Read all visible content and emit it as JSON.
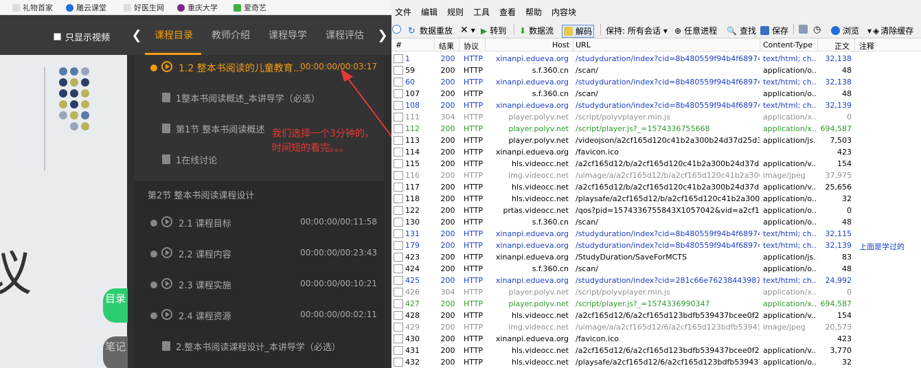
{
  "bookmarks": [
    "礼物首家",
    "雕云课堂",
    "好医生网",
    "重庆大学",
    "爱奇艺"
  ],
  "player": {
    "only_video_label": "只显示视频",
    "tabs": [
      "课程目录",
      "教师介绍",
      "课程导学",
      "课程评估"
    ],
    "active_tab": "课程目录",
    "left_arrow": "❮",
    "right_arrow": "❯",
    "lessons": [
      {
        "type": "video",
        "title": "1.2 整本书阅读的儿童教育...",
        "time": "00:00:00/00:03:17",
        "current": true
      },
      {
        "type": "doc",
        "title": "1整本书阅读概述_本讲导学（必选）",
        "time": ""
      },
      {
        "type": "doc",
        "title": "第1节 整本书阅读概述",
        "time": ""
      },
      {
        "type": "doc",
        "title": "1在线讨论",
        "time": ""
      }
    ],
    "section2_title": "第2节 整本书阅读课程设计",
    "lessons2": [
      {
        "type": "video",
        "title": "2.1 课程目标",
        "time": "00:00:00/00:11:58"
      },
      {
        "type": "video",
        "title": "2.2 课程内容",
        "time": "00:00:00/00:23:43"
      },
      {
        "type": "video",
        "title": "2.3 课程实施",
        "time": "00:00:00/00:10:21"
      },
      {
        "type": "video",
        "title": "2.4 课程资源",
        "time": "00:00:00/00:02:11"
      },
      {
        "type": "doc",
        "title": "2.整本书阅读课程设计_本讲导学（必选）",
        "time": ""
      }
    ],
    "annotation_line1": "我们选择一个3分钟的，",
    "annotation_line2": "时间短的看完。。。",
    "mulu": "目录",
    "biji": "笔记",
    "slide_char": "议"
  },
  "fiddler": {
    "menu": [
      "文件",
      "编辑",
      "规则",
      "工具",
      "查看",
      "帮助",
      "内容块"
    ],
    "toolbar": [
      "数据重放",
      "转到",
      "数据流",
      "解码",
      "保持: 所有会话",
      "任意进程",
      "查找",
      "保存",
      "浏览",
      "清除缓存"
    ],
    "columns": [
      "#",
      "结果",
      "协议",
      "Host",
      "URL",
      "Content-Type",
      "正文",
      "注释"
    ],
    "rows": [
      {
        "num": "1",
        "res": "200",
        "pro": "HTTP",
        "host": "xinanpi.edueva.org",
        "url": "/studyduration/index?cid=8b480559f94b4f689746...",
        "ct": "text/html; ch...",
        "body": "32,138",
        "note": "",
        "color": "#1a3fc4"
      },
      {
        "num": "59",
        "res": "200",
        "pro": "HTTP",
        "host": "s.f.360.cn",
        "url": "/scan/",
        "ct": "application/o...",
        "body": "48",
        "note": "",
        "color": "#000000"
      },
      {
        "num": "60",
        "res": "200",
        "pro": "HTTP",
        "host": "xinanpi.edueva.org",
        "url": "/studyduration/index?cid=8b480559f94b4f689746...",
        "ct": "text/html; ch...",
        "body": "32,138",
        "note": "",
        "color": "#1a3fc4"
      },
      {
        "num": "107",
        "res": "200",
        "pro": "HTTP",
        "host": "s.f.360.cn",
        "url": "/scan/",
        "ct": "application/o...",
        "body": "48",
        "note": "",
        "color": "#000000"
      },
      {
        "num": "108",
        "res": "200",
        "pro": "HTTP",
        "host": "xinanpi.edueva.org",
        "url": "/studyduration/index?cid=8b480559f94b4f689746...",
        "ct": "text/html; ch...",
        "body": "32,139",
        "note": "",
        "color": "#1a3fc4"
      },
      {
        "num": "111",
        "res": "304",
        "pro": "HTTP",
        "host": "player.polyv.net",
        "url": "/script/polyvplayer.min.js",
        "ct": "application/x...",
        "body": "0",
        "note": "",
        "color": "#909090"
      },
      {
        "num": "112",
        "res": "200",
        "pro": "HTTP",
        "host": "player.polyv.net",
        "url": "/script/player.js?_=1574336755668",
        "ct": "application/x...",
        "body": "694,587",
        "note": "",
        "color": "#2e9a2e"
      },
      {
        "num": "113",
        "res": "200",
        "pro": "HTTP",
        "host": "player.polyv.net",
        "url": "/videojson/a2cf165d120c41b2a300b24d37d25d3b_...",
        "ct": "application/js...",
        "body": "7,503",
        "note": "",
        "color": "#000000"
      },
      {
        "num": "114",
        "res": "200",
        "pro": "HTTP",
        "host": "xinanpi.edueva.org",
        "url": "/favicon.ico",
        "ct": "",
        "body": "423",
        "note": "",
        "color": "#000000"
      },
      {
        "num": "115",
        "res": "200",
        "pro": "HTTP",
        "host": "hls.videocc.net",
        "url": "/a2cf165d12/b/a2cf165d120c41b2a300b24d37d25...",
        "ct": "application/v...",
        "body": "154",
        "note": "",
        "color": "#000000"
      },
      {
        "num": "116",
        "res": "200",
        "pro": "HTTP",
        "host": "img.videocc.net",
        "url": "/uimage/a/a2cf165d12/b/a2cf165d120c41b2a300...",
        "ct": "image/jpeg",
        "body": "37,975",
        "note": "",
        "color": "#909090"
      },
      {
        "num": "117",
        "res": "200",
        "pro": "HTTP",
        "host": "hls.videocc.net",
        "url": "/a2cf165d12/b/a2cf165d120c41b2a300b24d37d25...",
        "ct": "application/v...",
        "body": "25,656",
        "note": "",
        "color": "#000000"
      },
      {
        "num": "118",
        "res": "200",
        "pro": "HTTP",
        "host": "hls.videocc.net",
        "url": "/playsafe/a2cf165d12/b/a2cf165d120c41b2a300b2...",
        "ct": "application/o...",
        "body": "32",
        "note": "",
        "color": "#000000"
      },
      {
        "num": "122",
        "res": "200",
        "pro": "HTTP",
        "host": "prtas.videocc.net",
        "url": "/qos?pid=1574336755843X1057042&vid=a2cf165d...",
        "ct": "application/o...",
        "body": "0",
        "note": "",
        "color": "#000000"
      },
      {
        "num": "130",
        "res": "200",
        "pro": "HTTP",
        "host": "s.f.360.cn",
        "url": "/scan/",
        "ct": "application/o...",
        "body": "48",
        "note": "",
        "color": "#000000"
      },
      {
        "num": "131",
        "res": "200",
        "pro": "HTTP",
        "host": "xinanpi.edueva.org",
        "url": "/studyduration/index?cid=8b480559f94b4f689746...",
        "ct": "text/html; ch...",
        "body": "32,115",
        "note": "",
        "color": "#1a3fc4"
      },
      {
        "num": "179",
        "res": "200",
        "pro": "HTTP",
        "host": "xinanpi.edueva.org",
        "url": "/studyduration/index?cid=8b480559f94b4f689746...",
        "ct": "text/html; ch...",
        "body": "32,139",
        "note": "上面是学过的",
        "color": "#1a3fc4"
      },
      {
        "num": "423",
        "res": "200",
        "pro": "HTTP",
        "host": "xinanpi.edueva.org",
        "url": "/StudyDuration/SaveForMCTS",
        "ct": "application/js...",
        "body": "83",
        "note": "",
        "color": "#000000"
      },
      {
        "num": "424",
        "res": "200",
        "pro": "HTTP",
        "host": "s.f.360.cn",
        "url": "/scan/",
        "ct": "application/o...",
        "body": "48",
        "note": "",
        "color": "#000000"
      },
      {
        "num": "425",
        "res": "200",
        "pro": "HTTP",
        "host": "xinanpi.edueva.org",
        "url": "/studyduration/index?cid=281c66e762384439877a...",
        "ct": "text/html; ch...",
        "body": "24,992",
        "note": "",
        "color": "#1a3fc4"
      },
      {
        "num": "426",
        "res": "304",
        "pro": "HTTP",
        "host": "player.polyv.net",
        "url": "/script/polyvplayer.min.js",
        "ct": "application/x...",
        "body": "0",
        "note": "",
        "color": "#909090"
      },
      {
        "num": "427",
        "res": "200",
        "pro": "HTTP",
        "host": "player.polyv.net",
        "url": "/script/player.js?_=1574336990347",
        "ct": "application/x...",
        "body": "694,587",
        "note": "",
        "color": "#2e9a2e"
      },
      {
        "num": "428",
        "res": "200",
        "pro": "HTTP",
        "host": "hls.videocc.net",
        "url": "/a2cf165d12/6/a2cf165d123bdfb539437bcee0f200...",
        "ct": "application/v...",
        "body": "154",
        "note": "",
        "color": "#000000"
      },
      {
        "num": "429",
        "res": "200",
        "pro": "HTTP",
        "host": "img.videocc.net",
        "url": "/uimage/a/a2cf165d12/6/a2cf165d123bdfb539437...",
        "ct": "image/jpeg",
        "body": "20,573",
        "note": "",
        "color": "#909090"
      },
      {
        "num": "430",
        "res": "200",
        "pro": "HTTP",
        "host": "xinanpi.edueva.org",
        "url": "/favicon.ico",
        "ct": "",
        "body": "423",
        "note": "",
        "color": "#000000"
      },
      {
        "num": "431",
        "res": "200",
        "pro": "HTTP",
        "host": "hls.videocc.net",
        "url": "/a2cf165d12/6/a2cf165d123bdfb539437bcee0f200...",
        "ct": "application/v...",
        "body": "3,770",
        "note": "",
        "color": "#000000"
      },
      {
        "num": "432",
        "res": "200",
        "pro": "HTTP",
        "host": "hls.videocc.net",
        "url": "/playsafe/a2cf165d12/6/a2cf165d123bdfb539437b...",
        "ct": "application/o...",
        "body": "32",
        "note": "",
        "color": "#000000"
      }
    ]
  }
}
